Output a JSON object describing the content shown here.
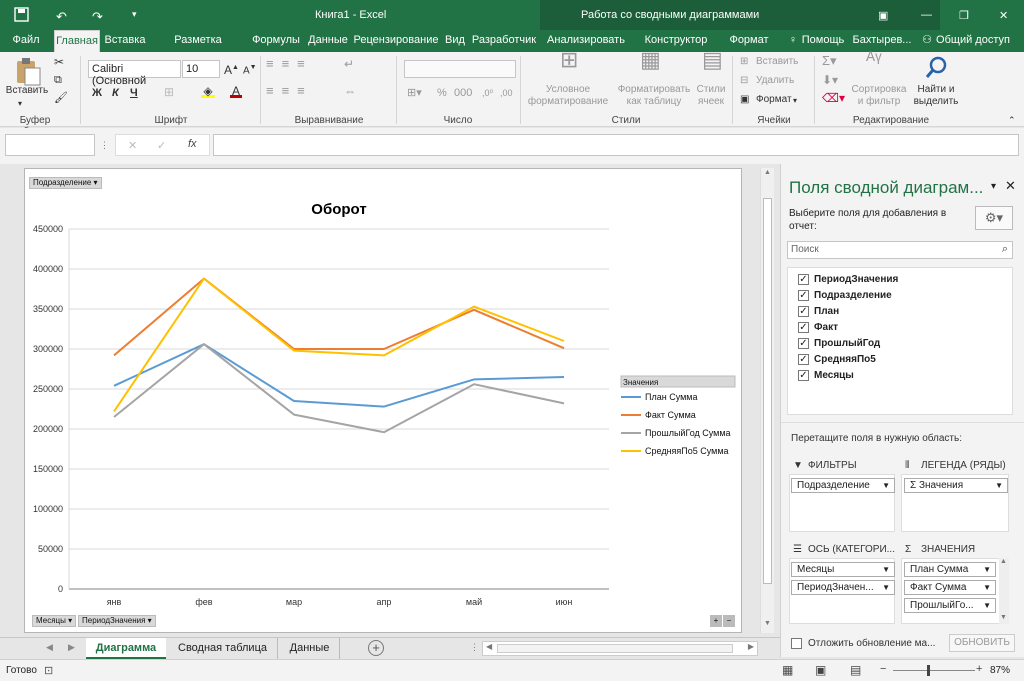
{
  "window": {
    "title": "Книга1 - Excel",
    "context_title": "Работа со сводными диаграммами"
  },
  "tabs": [
    "Файл",
    "Главная",
    "Вставка",
    "Разметка страницы",
    "Формулы",
    "Данные",
    "Рецензирование",
    "Вид",
    "Разработчик",
    "Анализировать",
    "Конструктор",
    "Формат"
  ],
  "help": "Помощь",
  "user": "Бахтырев...",
  "share": "Общий доступ",
  "ribbon": {
    "paste": "Вставить",
    "clipboard": "Буфер обмена",
    "font_name": "Calibri (Основной",
    "font_size": "10",
    "font_group": "Шрифт",
    "bold": "Ж",
    "italic": "К",
    "underline": "Ч",
    "align_group": "Выравнивание",
    "number_group": "Число",
    "cond_format": "Условное форматирование",
    "format_table": "Форматировать как таблицу",
    "cell_styles": "Стили ячеек",
    "styles_group": "Стили",
    "insert": "Вставить",
    "delete": "Удалить",
    "format": "Формат",
    "cells_group": "Ячейки",
    "sort_filter": "Сортировка и фильтр",
    "find_select": "Найти и выделить",
    "edit_group": "Редактирование"
  },
  "formula_bar": {
    "fx": "fx",
    "name_box": "",
    "value": ""
  },
  "chart_data": {
    "type": "line",
    "title": "Оборот",
    "categories": [
      "янв",
      "фев",
      "мар",
      "апр",
      "май",
      "июн"
    ],
    "ylim": [
      0,
      450000
    ],
    "yticks": [
      "0",
      "50000",
      "100000",
      "150000",
      "200000",
      "250000",
      "300000",
      "350000",
      "400000",
      "450000"
    ],
    "legend_title": "Значения",
    "legend_position": "right",
    "grid": true,
    "series": [
      {
        "name": "План Сумма",
        "color": "#5b9bd5",
        "values": [
          254000,
          306000,
          235000,
          228000,
          262000,
          265000
        ]
      },
      {
        "name": "Факт Сумма",
        "color": "#ed7d31",
        "values": [
          292000,
          388000,
          300000,
          300000,
          349000,
          301000
        ]
      },
      {
        "name": "ПрошлыйГод Сумма",
        "color": "#a5a5a5",
        "values": [
          215000,
          306000,
          218000,
          196000,
          256000,
          232000
        ]
      },
      {
        "name": "СредняяПо5 Сумма",
        "color": "#ffc000",
        "values": [
          222000,
          388000,
          298000,
          292000,
          353000,
          310000
        ]
      }
    ],
    "filter_buttons": {
      "top": "Подразделение",
      "axis1": "Месяцы",
      "axis2": "ПериодЗначения"
    }
  },
  "panel": {
    "title": "Поля сводной диаграм...",
    "subtitle": "Выберите поля для добавления в отчет:",
    "search_placeholder": "Поиск",
    "fields": [
      "ПериодЗначения",
      "Подразделение",
      "План",
      "Факт",
      "ПрошлыйГод",
      "СредняяПо5",
      "Месяцы"
    ],
    "drag_hint": "Перетащите поля в нужную область:",
    "filters_label": "ФИЛЬТРЫ",
    "legend_label": "ЛЕГЕНДА (РЯДЫ)",
    "axis_label": "ОСЬ (КАТЕГОРИ...",
    "values_label": "ЗНАЧЕНИЯ",
    "filters_items": [
      "Подразделение"
    ],
    "legend_items": [
      "Σ  Значения"
    ],
    "axis_items": [
      "Месяцы",
      "ПериодЗначен..."
    ],
    "values_items": [
      "План Сумма",
      "Факт Сумма",
      "ПрошлыйГо..."
    ],
    "defer": "Отложить обновление ма...",
    "update": "ОБНОВИТЬ"
  },
  "sheets": [
    "Диаграмма",
    "Сводная таблица",
    "Данные"
  ],
  "status": {
    "ready": "Готово",
    "zoom": "87%"
  }
}
